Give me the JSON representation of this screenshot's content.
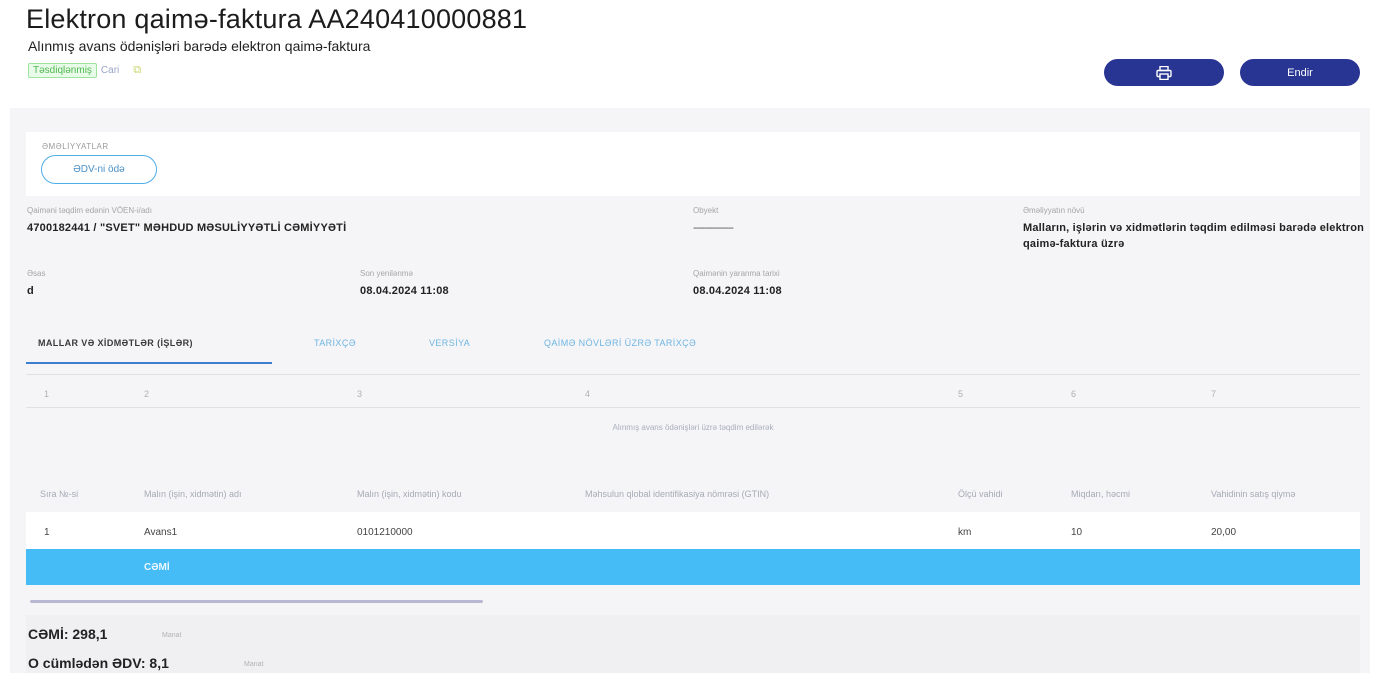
{
  "header": {
    "title": "Elektron qaimə-faktura AA240410000881",
    "subtitle": "Alınmış avans ödənişləri barədə elektron qaimə-faktura",
    "status_badge": "Təsdiqlənmiş",
    "status_extra": "Cari",
    "status_icon": "copy-icon"
  },
  "toolbar": {
    "print_icon": "printer-icon",
    "download_label": "Endir"
  },
  "actions": {
    "label": "ƏMƏLİYYATLAR",
    "vat_pay_label": "ƏDV-ni ödə"
  },
  "fields": {
    "sender_label": "Qaiməni təqdim edənin VÖEN-i/adı",
    "sender_value": "4700182441 / \"SVET\" MƏHDUD MƏSULİYYƏTLİ CƏMİYYƏTİ",
    "object_label": "Obyekt",
    "object_value": "---------------",
    "operation_label": "Əməliyyatın növü",
    "operation_value": "Malların, işlərin və xidmətlərin təqdim edilməsi barədə elektron qaimə-faktura üzrə",
    "basis_label": "Əsas",
    "basis_value": "d",
    "last_edit_label": "Son yenilənmə",
    "last_edit_value": "08.04.2024 11:08",
    "created_label": "Qaimənin yaranma tarixi",
    "created_value": "08.04.2024 11:08"
  },
  "tabs": [
    {
      "label": "MALLAR VƏ XİDMƏTLƏR (İŞLƏR)"
    },
    {
      "label": "TARİXÇƏ"
    },
    {
      "label": "VERSİYA"
    },
    {
      "label": "QAİMƏ NÖVLƏRİ ÜZRƏ TARİXÇƏ"
    }
  ],
  "table": {
    "column_numbers": [
      "1",
      "2",
      "3",
      "4",
      "5",
      "6",
      "7"
    ],
    "note": "Alınmış avans ödənişləri üzrə təqdim edilərək",
    "headers": [
      "Sıra №-si",
      "Malın (işin, xidmətin) adı",
      "Malın (işin, xidmətin) kodu",
      "Məhsulun qlobal identifikasiya nömrəsi (GTIN)",
      "Ölçü vahidi",
      "Miqdarı, həcmi",
      "Vahidinin satış qiymə"
    ],
    "rows": [
      {
        "no": "1",
        "name": "Avans1",
        "code": "0101210000",
        "gtin": "",
        "unit": "km",
        "qty": "10",
        "price": "20,00"
      }
    ],
    "total_label": "CƏMİ"
  },
  "summary": {
    "total_line": "CƏMİ: 298,1",
    "total_unit": "Manat",
    "vat_line": "O cümlədən ƏDV: 8,1",
    "vat_unit": "Manat"
  },
  "colors": {
    "primary": "#283593",
    "accent": "#45bcf5",
    "success": "#4fb84f"
  }
}
